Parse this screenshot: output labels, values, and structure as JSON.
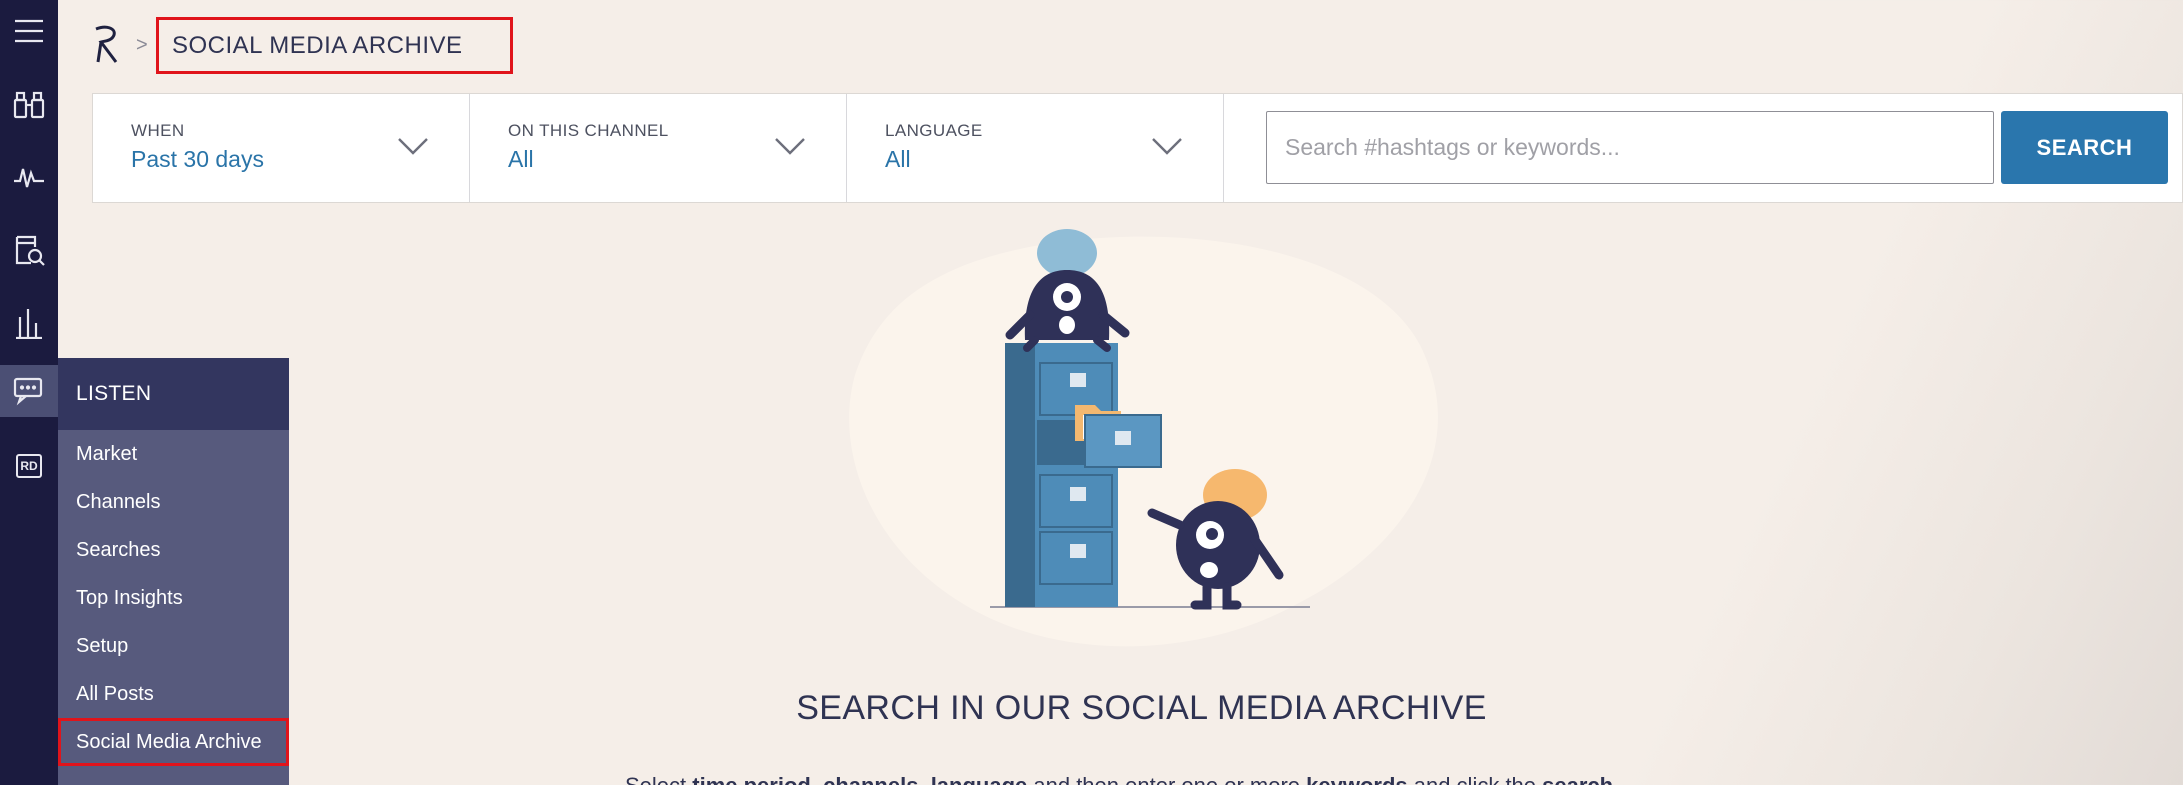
{
  "breadcrumb": {
    "title": "SOCIAL MEDIA ARCHIVE",
    "separator": ">"
  },
  "rail": {
    "items": [
      {
        "icon": "hamburger-menu-icon"
      },
      {
        "icon": "binoculars-icon"
      },
      {
        "icon": "pulse-icon"
      },
      {
        "icon": "document-search-icon"
      },
      {
        "icon": "bar-chart-icon"
      },
      {
        "icon": "chat-bubbles-icon",
        "active": true
      },
      {
        "icon": "rd-badge-icon",
        "label": "RD"
      }
    ]
  },
  "flyout": {
    "heading": "LISTEN",
    "items": [
      {
        "label": "Market"
      },
      {
        "label": "Channels"
      },
      {
        "label": "Searches"
      },
      {
        "label": "Top Insights"
      },
      {
        "label": "Setup"
      },
      {
        "label": "All Posts"
      },
      {
        "label": "Social Media Archive",
        "selected": true
      }
    ]
  },
  "filters": {
    "when": {
      "label": "WHEN",
      "value": "Past 30 days"
    },
    "channel": {
      "label": "ON THIS CHANNEL",
      "value": "All"
    },
    "language": {
      "label": "LANGUAGE",
      "value": "All"
    }
  },
  "search": {
    "placeholder": "Search #hashtags or keywords...",
    "value": "",
    "button_label": "SEARCH"
  },
  "empty_state": {
    "title": "SEARCH IN OUR SOCIAL MEDIA ARCHIVE",
    "description_parts": [
      {
        "text": "Select ",
        "bold": false
      },
      {
        "text": "time period",
        "bold": true
      },
      {
        "text": ", ",
        "bold": false
      },
      {
        "text": "channels",
        "bold": true
      },
      {
        "text": ", ",
        "bold": false
      },
      {
        "text": "language",
        "bold": true
      },
      {
        "text": " and then enter one or more ",
        "bold": false
      },
      {
        "text": "keywords",
        "bold": true
      },
      {
        "text": " and click the ",
        "bold": false
      },
      {
        "text": "search",
        "bold": true
      }
    ]
  },
  "colors": {
    "rail_bg": "#1b1b3f",
    "flyout_bg": "#575a7d",
    "flyout_head_bg": "#33365f",
    "accent": "#2a76ad",
    "highlight": "#e0141b",
    "page_bg": "#f5eee8"
  }
}
